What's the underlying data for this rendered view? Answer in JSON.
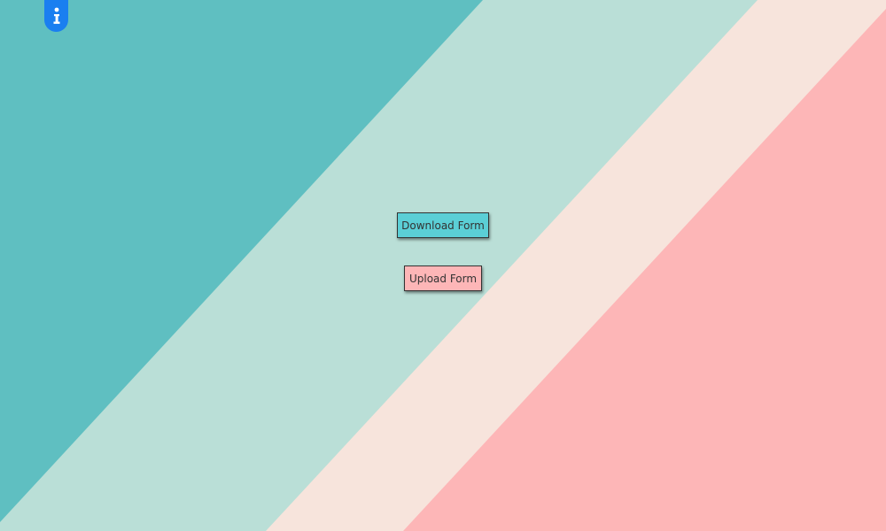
{
  "header": {
    "info_icon": "info-icon"
  },
  "actions": {
    "download_label": "Download Form",
    "upload_label": "Upload Form"
  },
  "colors": {
    "band_teal": "#5fbfc1",
    "band_mint": "#badfd7",
    "band_cream": "#f7e4dc",
    "band_pink": "#fdb6b7",
    "info_blue": "#1a7ff0",
    "download_button": "#5bcfd6",
    "upload_button": "#fdb6b7"
  }
}
